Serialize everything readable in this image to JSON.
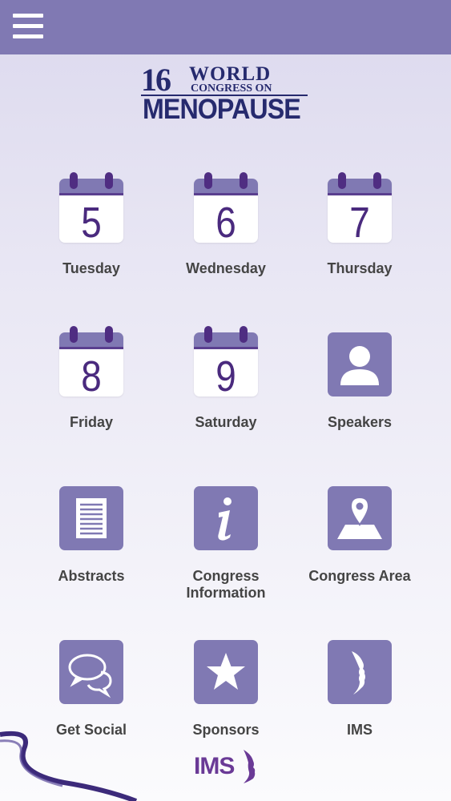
{
  "header": {
    "menu_icon": "hamburger-menu-icon",
    "bar_color": "#8079b3"
  },
  "logo": {
    "number": "16",
    "line1": "WORLD",
    "line2": "CONGRESS ON",
    "line3": "MENOPAUSE",
    "color": "#262a6e"
  },
  "tiles": [
    {
      "label": "Tuesday",
      "day": "5",
      "icon": "calendar-icon"
    },
    {
      "label": "Wednesday",
      "day": "6",
      "icon": "calendar-icon"
    },
    {
      "label": "Thursday",
      "day": "7",
      "icon": "calendar-icon"
    },
    {
      "label": "Friday",
      "day": "8",
      "icon": "calendar-icon"
    },
    {
      "label": "Saturday",
      "day": "9",
      "icon": "calendar-icon"
    },
    {
      "label": "Speakers",
      "icon": "person-icon"
    },
    {
      "label": "Abstracts",
      "icon": "document-icon"
    },
    {
      "label_line1": "Congress",
      "label_line2": "Information",
      "icon": "info-icon"
    },
    {
      "label": "Congress Area",
      "icon": "map-pin-icon"
    },
    {
      "label": "Get Social",
      "icon": "chat-bubbles-icon"
    },
    {
      "label": "Sponsors",
      "icon": "star-icon"
    },
    {
      "label": "IMS",
      "icon": "ims-profile-icon"
    }
  ],
  "footer": {
    "logo_text": "IMS",
    "accent": "#6a3a96"
  }
}
